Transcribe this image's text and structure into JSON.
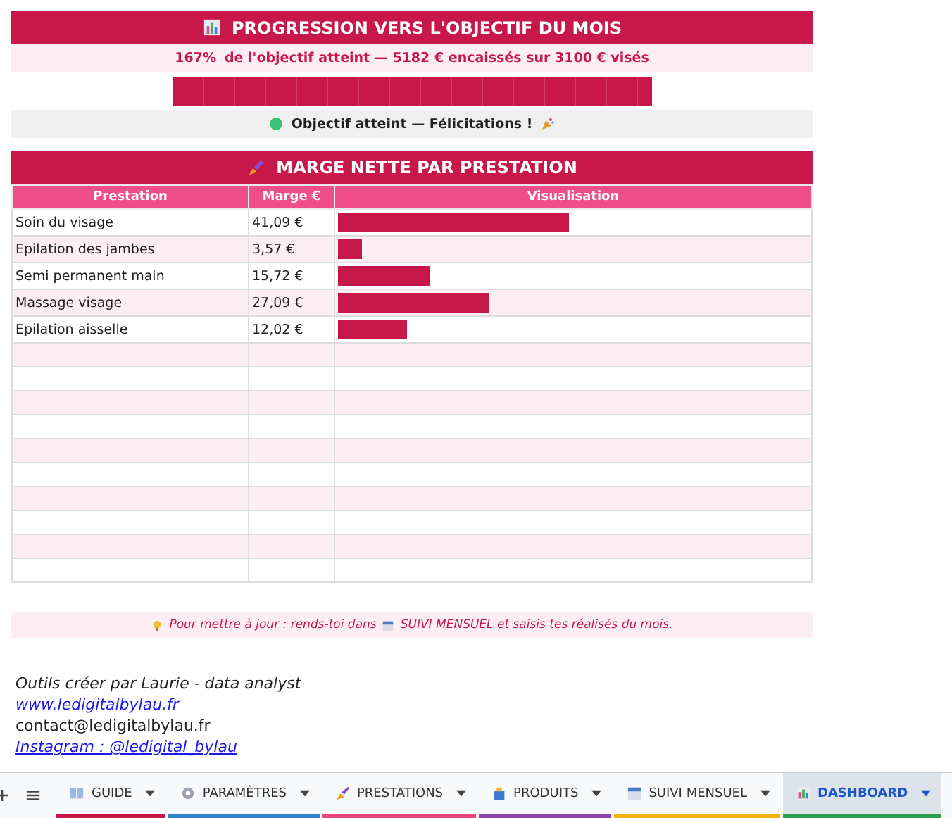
{
  "progress": {
    "title": "PROGRESSION VERS L'OBJECTIF DU MOIS",
    "summary_percent": "167%",
    "summary_text": "de l'objectif atteint  —  5182 € encaissés sur 3100 € visés",
    "status": "Objectif atteint — Félicitations !"
  },
  "margin": {
    "title": "MARGE NETTE PAR PRESTATION",
    "columns": [
      "Prestation",
      "Marge €",
      "Visualisation"
    ],
    "rows": [
      {
        "name": "Soin du visage",
        "value": "41,09 €",
        "level": 0.49
      },
      {
        "name": "Epilation des jambes",
        "value": "3,57 €",
        "level": 0.05
      },
      {
        "name": "Semi permanent main",
        "value": "15,72 €",
        "level": 0.196
      },
      {
        "name": "Massage visage",
        "value": "27,09 €",
        "level": 0.32
      },
      {
        "name": "Epilation aisselle",
        "value": "12,02 €",
        "level": 0.146
      }
    ]
  },
  "note": {
    "before": "Pour mettre à jour : rends-toi dans",
    "after": "SUIVI MENSUEL et saisis tes réalisés du mois."
  },
  "credits": {
    "author": "Outils créer par Laurie - data analyst",
    "website": "www.ledigitalbylau.fr",
    "email": "contact@ledigitalbylau.fr",
    "instagram": "Instagram : @ledigital_bylau"
  },
  "sheet_tabs": [
    {
      "label": "GUIDE",
      "kind": "book",
      "color": "#c8184a",
      "selected": false
    },
    {
      "label": "PARAMÈTRES",
      "kind": "gear",
      "color": "#2f80c8",
      "selected": false
    },
    {
      "label": "PRESTATIONS",
      "kind": "brush",
      "color": "#e8457a",
      "selected": false
    },
    {
      "label": "PRODUITS",
      "kind": "bag",
      "color": "#8e44ad",
      "selected": false
    },
    {
      "label": "SUIVI MENSUEL",
      "kind": "calendar",
      "color": "#f0b400",
      "selected": false
    },
    {
      "label": "DASHBOARD",
      "kind": "chart",
      "color": "#2e9e4f",
      "selected": true
    }
  ]
}
